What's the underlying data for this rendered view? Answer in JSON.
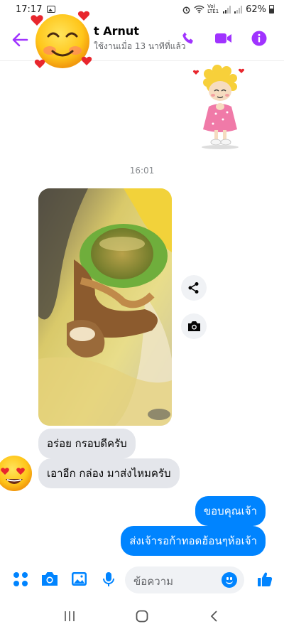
{
  "status_bar": {
    "time": "17:17",
    "network": "Vo) LTE1",
    "battery": "62%"
  },
  "header": {
    "contact_name": "t Arnut",
    "contact_status": "ใช้งานเมื่อ 13 นาทีที่แล้ว"
  },
  "chat": {
    "timestamp": "16:01",
    "messages": [
      {
        "direction": "in",
        "text": "อร่อย กรอบดีครับ"
      },
      {
        "direction": "in",
        "text": "เอาอีก กล่อง มาส่งไหมครับ"
      },
      {
        "direction": "out",
        "text": "ขอบคุณเจ้า"
      },
      {
        "direction": "out",
        "text": "ส่งเจ้ารอก้าทอดฮ้อนๆห้อเจ้า"
      }
    ]
  },
  "composer": {
    "placeholder": "ข้อความ"
  },
  "colors": {
    "accent": "#0084ff",
    "header_icons": "#a033ff",
    "incoming_bubble": "#e4e6eb"
  },
  "icons": [
    "back-arrow-icon",
    "phone-icon",
    "video-icon",
    "info-icon",
    "share-icon",
    "camera-icon",
    "apps-icon",
    "image-icon",
    "mic-icon",
    "emoji-icon",
    "like-icon"
  ]
}
